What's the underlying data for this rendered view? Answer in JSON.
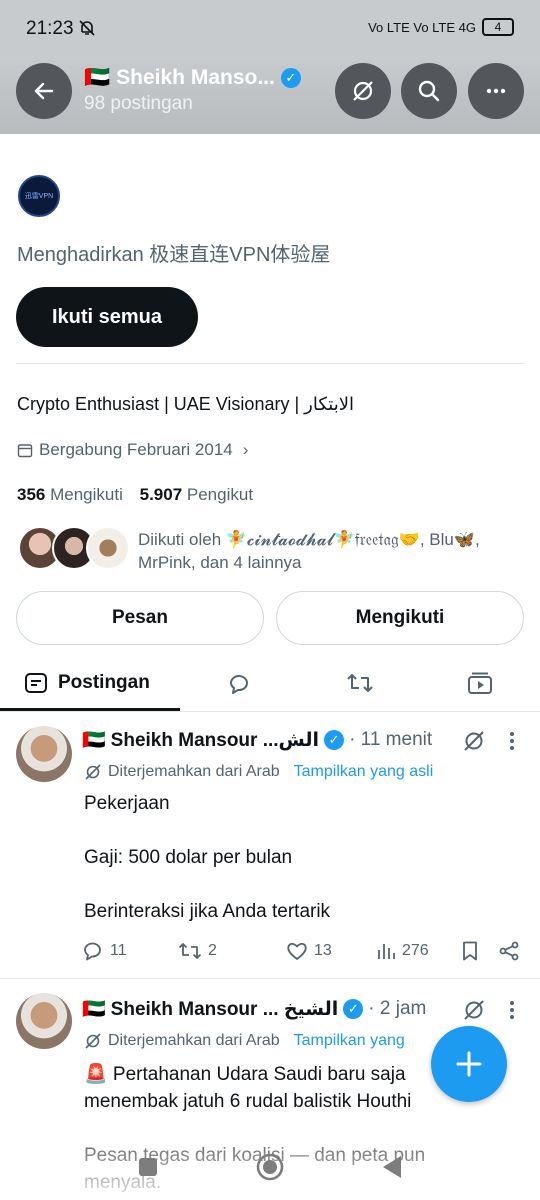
{
  "status_bar": {
    "time": "21:23",
    "network": "Vo LTE  Vo LTE 4G",
    "battery": "4"
  },
  "header": {
    "flag": "🇦🇪",
    "name": "Sheikh Manso...",
    "post_count": "98 postingan"
  },
  "promo": {
    "logo_text": "迅雷VPN",
    "text": "Menghadirkan 极速直连VPN体验屋",
    "follow_all_label": "Ikuti semua"
  },
  "profile": {
    "bio": "Crypto Enthusiast | UAE Visionary | الابتكار",
    "joined": "Bergabung Februari 2014",
    "following_count": "356",
    "following_label": "Mengikuti",
    "followers_count": "5.907",
    "followers_label": "Pengikut",
    "followed_by": "Diikuti oleh 🧚𝓬𝓲𝓷𝓽𝓪𝓸𝓭𝓱𝓪𝓵🧚𝔣𝔯𝔢𝔢𝔱𝔞𝔤🤝, Blu🦋, MrPink, dan 4 lainnya",
    "message_label": "Pesan",
    "following_button_label": "Mengikuti"
  },
  "tabs": [
    {
      "label": "Postingan",
      "icon": "posts-icon",
      "active": true
    },
    {
      "label": "",
      "icon": "replies-icon",
      "active": false
    },
    {
      "label": "",
      "icon": "retweet-icon",
      "active": false
    },
    {
      "label": "",
      "icon": "media-icon",
      "active": false
    }
  ],
  "tweets": [
    {
      "flag": "🇦🇪",
      "author": "Sheikh Mansour ...الش",
      "time": "· 11 menit",
      "translated": "Diterjemahkan dari Arab",
      "show_original": "Tampilkan yang asli",
      "body": "Pekerjaan\n\nGaji: 500 dolar per bulan\n\nBerinteraksi jika Anda tertarik",
      "replies": "11",
      "retweets": "2",
      "likes": "13",
      "views": "276"
    },
    {
      "flag": "🇦🇪",
      "author": "Sheikh Mansour ... الشيخ",
      "time": "· 2 jam",
      "translated": "Diterjemahkan dari Arab",
      "show_original": "Tampilkan yang",
      "body": "🚨 Pertahanan Udara Saudi baru saja menembak jatuh 6 rudal balistik Houthi\n\nPesan tegas dari koalisi — dan peta pun menyala."
    }
  ],
  "colors": {
    "accent": "#1d9bf0",
    "text_primary": "#0f1419",
    "text_secondary": "#536471",
    "header_bg": "#c8cbce"
  }
}
